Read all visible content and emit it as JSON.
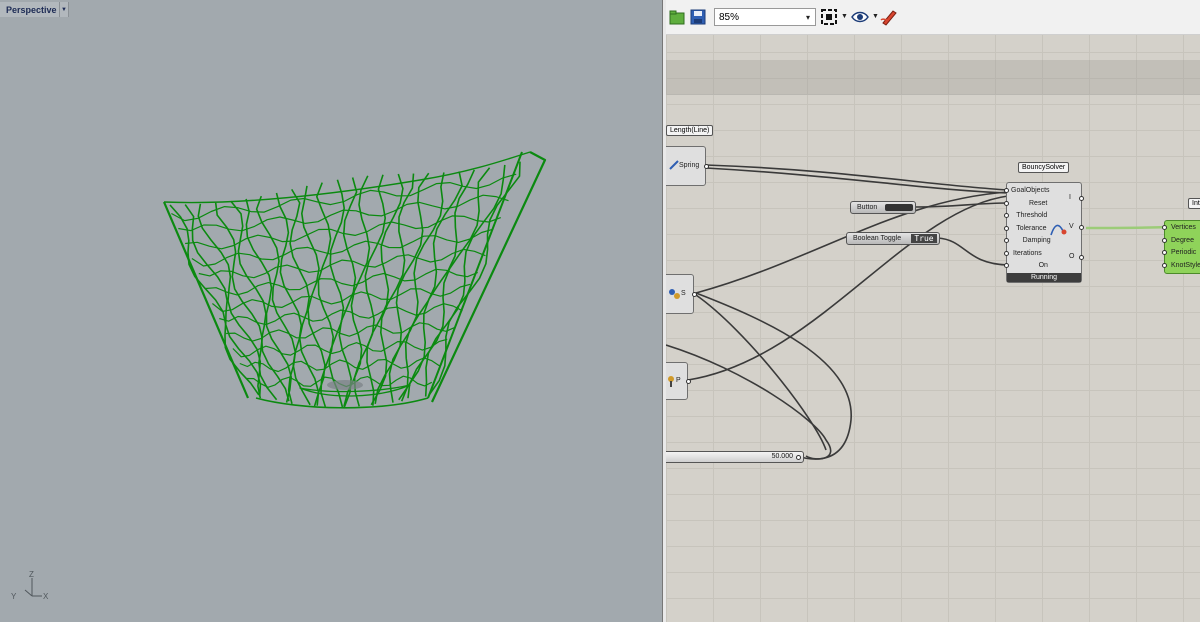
{
  "viewport": {
    "title": "Perspective",
    "menu_glyph": "▼",
    "axis": {
      "z": "Z",
      "y": "Y",
      "x": "X"
    },
    "wire_color": "#0b8a10",
    "background": "#a2a9ae"
  },
  "toolbar": {
    "zoom": "85%",
    "zoom_arrow": "▾",
    "open_icon": "folder-open-icon",
    "save_icon": "floppy-save-icon",
    "zoom_extents_icon": "zoom-extents-icon",
    "preview_icon": "eye-preview-icon",
    "sketch_icon": "pen-sketch-icon"
  },
  "canvas": {
    "length_tag": "Length(Line)",
    "spring_label": "Spring",
    "s_label": "S",
    "p_label": "P",
    "button_label": "Button",
    "toggle_label": "Boolean Toggle",
    "toggle_value": "True",
    "slider_value": "50.000",
    "solver": {
      "title": "BouncySolver",
      "inputs": [
        "GoalObjects",
        "Reset",
        "Threshold",
        "Tolerance",
        "Damping",
        "Iterations",
        "On"
      ],
      "out_i": "I",
      "out_v": "V",
      "out_o": "O",
      "status": "Running"
    },
    "interp": {
      "tag": "Inte",
      "inputs": [
        "Vertices",
        "Degree",
        "Periodic",
        "KnotStyle"
      ]
    }
  }
}
